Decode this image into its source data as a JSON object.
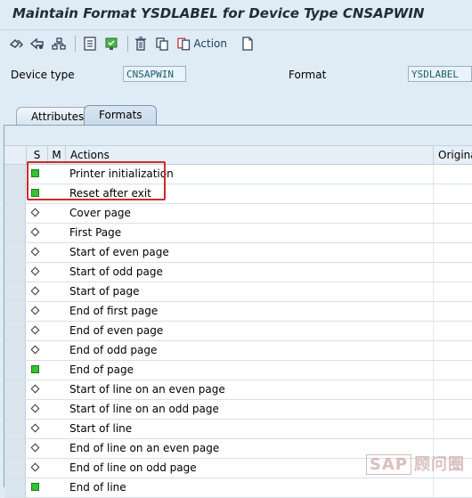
{
  "window": {
    "title": "Maintain Format YSDLABEL for Device Type CNSAPWIN"
  },
  "toolbar": {
    "buttons": [
      {
        "icon": "display-change-icon"
      },
      {
        "icon": "other-object-icon"
      },
      {
        "icon": "hierarchy-icon"
      },
      {
        "icon": "document-list-icon"
      },
      {
        "icon": "activate-icon"
      },
      {
        "icon": "delete-icon"
      },
      {
        "icon": "copy-icon"
      },
      {
        "icon": "action-icon",
        "label": "Action"
      },
      {
        "icon": "new-page-icon"
      }
    ]
  },
  "fields": {
    "device_type_label": "Device type",
    "device_type_value": "CNSAPWIN",
    "format_label": "Format",
    "format_value": "YSDLABEL"
  },
  "tabs": [
    {
      "label": "Attributes",
      "active": false
    },
    {
      "label": "Formats",
      "active": true
    }
  ],
  "table": {
    "columns": {
      "s": "S",
      "m": "M",
      "actions": "Actions",
      "original": "Origina"
    },
    "rows": [
      {
        "status": "green",
        "action": "Printer initialization"
      },
      {
        "status": "green",
        "action": "Reset after exit"
      },
      {
        "status": "empty",
        "action": "Cover page"
      },
      {
        "status": "empty",
        "action": "First Page"
      },
      {
        "status": "empty",
        "action": "Start of even page"
      },
      {
        "status": "empty",
        "action": "Start of odd page"
      },
      {
        "status": "empty",
        "action": "Start of page"
      },
      {
        "status": "empty",
        "action": "End of first page"
      },
      {
        "status": "empty",
        "action": "End of even page"
      },
      {
        "status": "empty",
        "action": "End of odd page"
      },
      {
        "status": "green",
        "action": "End of page"
      },
      {
        "status": "empty",
        "action": "Start of line on an even page"
      },
      {
        "status": "empty",
        "action": "Start of line on an odd page"
      },
      {
        "status": "empty",
        "action": "Start of line"
      },
      {
        "status": "empty",
        "action": "End of line on an even page"
      },
      {
        "status": "empty",
        "action": "End of line on odd page"
      },
      {
        "status": "green",
        "action": "End of line"
      }
    ]
  },
  "watermark": {
    "brand": "SAP",
    "text": "顾问圈"
  },
  "colors": {
    "status_green": "#35c235",
    "highlight_red": "#cc2b2b",
    "background": "#dfebf5"
  }
}
